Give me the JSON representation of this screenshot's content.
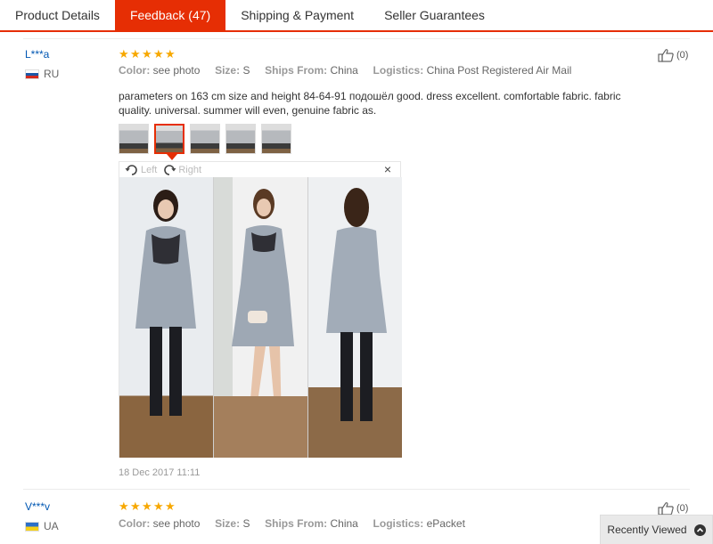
{
  "tabs": [
    {
      "label": "Product Details"
    },
    {
      "label": "Feedback (47)"
    },
    {
      "label": "Shipping & Payment"
    },
    {
      "label": "Seller Guarantees"
    }
  ],
  "reviews": [
    {
      "user": "L***a",
      "country": "RU",
      "stars": 5,
      "color_label": "Color:",
      "color_value": "see photo",
      "size_label": "Size:",
      "size_value": "S",
      "ships_label": "Ships From:",
      "ships_value": "China",
      "logistics_label": "Logistics:",
      "logistics_value": "China Post Registered Air Mail",
      "helpful": "(0)",
      "text": "parameters on 163 cm size and height 84-64-91 подошёл good. dress excellent. comfortable fabric. fabric quality. universal. summer will even, genuine fabric as.",
      "viewer": {
        "rotate_left": "Left",
        "rotate_right": "Right",
        "close": "×"
      },
      "date": "18 Dec 2017 11:11"
    },
    {
      "user": "V***v",
      "country": "UA",
      "stars": 5,
      "color_label": "Color:",
      "color_value": "see photo",
      "size_label": "Size:",
      "size_value": "S",
      "ships_label": "Ships From:",
      "ships_value": "China",
      "logistics_label": "Logistics:",
      "logistics_value": "ePacket",
      "helpful": "(0)"
    }
  ],
  "recently_viewed": "Recently Viewed",
  "icons": {
    "star": "star-icon",
    "thumbs_up": "thumbs-up-icon",
    "rotate_left": "rotate-left-icon",
    "rotate_right": "rotate-right-icon",
    "close": "close-icon",
    "chevron_up": "chevron-up-icon"
  },
  "colors": {
    "accent": "#e62e04",
    "link": "#0057b3",
    "star": "#f7a800"
  }
}
